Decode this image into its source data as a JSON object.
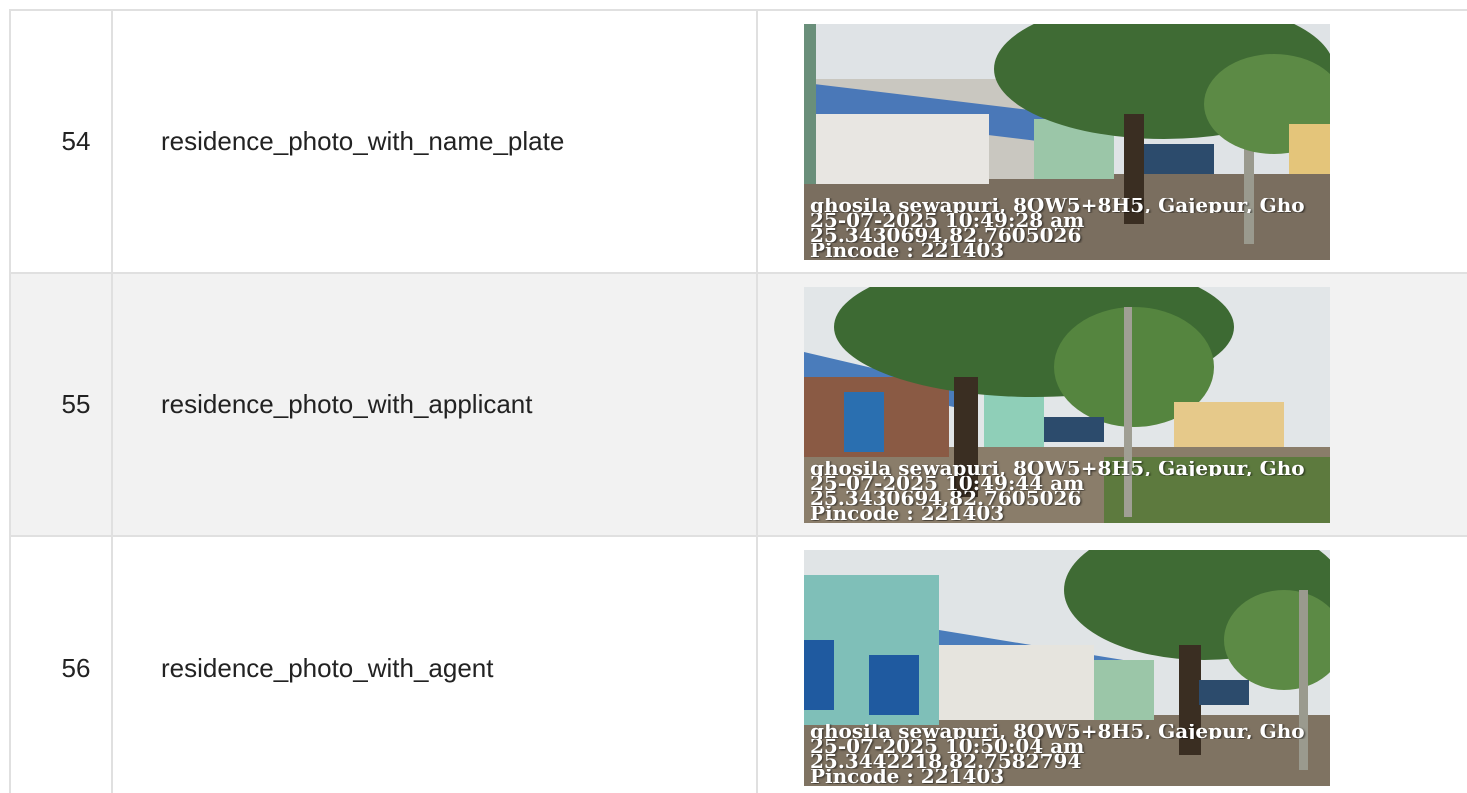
{
  "rows": [
    {
      "index": "54",
      "name": "residence_photo_with_name_plate",
      "photo": {
        "location": "ghosila sewapuri, 8QW5+8H5, Gajepur, Gho",
        "datetime": "25-07-2025 10:49:28 am",
        "coords": "25.3430694,82.7605026",
        "pincode": "Pincode : 221403"
      }
    },
    {
      "index": "55",
      "name": "residence_photo_with_applicant",
      "photo": {
        "location": "ghosila sewapuri, 8QW5+8H5, Gajepur, Gho",
        "datetime": "25-07-2025 10:49:44 am",
        "coords": "25.3430694,82.7605026",
        "pincode": "Pincode : 221403"
      }
    },
    {
      "index": "56",
      "name": "residence_photo_with_agent",
      "photo": {
        "location": "ghosila sewapuri, 8QW5+8H5, Gajepur, Gho",
        "datetime": "25-07-2025 10:50:04 am",
        "coords": "25.3442218,82.7582794",
        "pincode": "Pincode : 221403"
      }
    }
  ]
}
